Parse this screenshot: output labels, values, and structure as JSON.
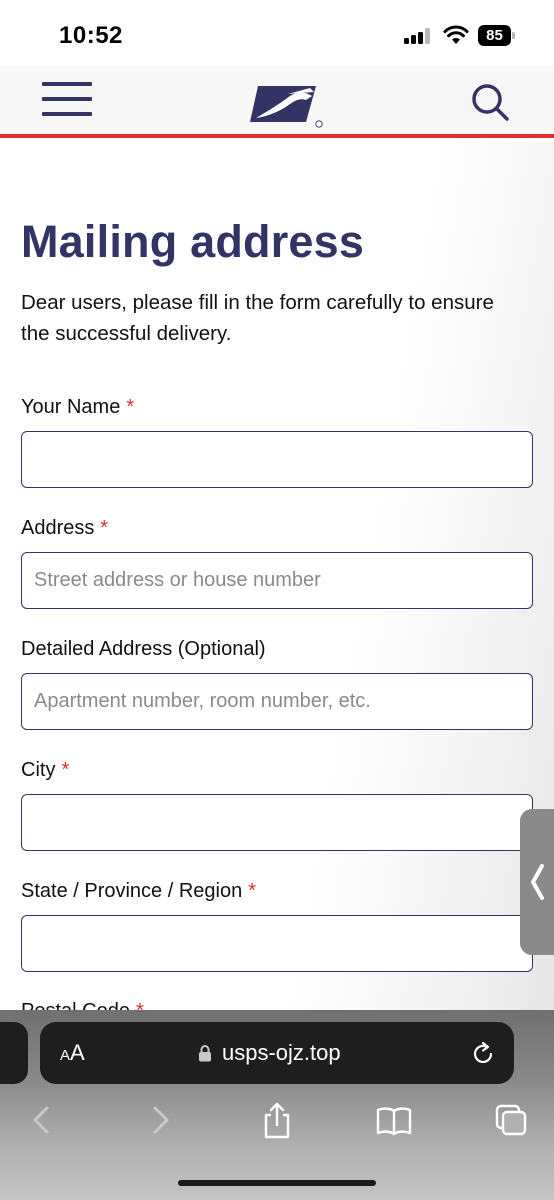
{
  "status_bar": {
    "time": "10:52",
    "battery": "85"
  },
  "header": {
    "menu_icon": "hamburger-menu-icon",
    "logo_icon": "usps-eagle-logo",
    "search_icon": "search-icon"
  },
  "main": {
    "title": "Mailing address",
    "intro": "Dear users, please fill in the form carefully to ensure the successful delivery.",
    "fields": [
      {
        "label": "Your Name",
        "required_mark": "*",
        "placeholder": "",
        "value": ""
      },
      {
        "label": "Address",
        "required_mark": "*",
        "placeholder": "Street address or house number",
        "value": ""
      },
      {
        "label": "Detailed Address (Optional)",
        "required_mark": "",
        "placeholder": "Apartment number, room number, etc.",
        "value": ""
      },
      {
        "label": "City",
        "required_mark": "*",
        "placeholder": "",
        "value": ""
      },
      {
        "label": "State / Province / Region",
        "required_mark": "*",
        "placeholder": "",
        "value": ""
      },
      {
        "label": "Postal Code",
        "required_mark": "*",
        "placeholder": "",
        "value": ""
      }
    ]
  },
  "browser": {
    "aa_large": "A",
    "aa_small": "A",
    "url": "usps-ojz.top",
    "toolbar_icons": [
      "back-icon",
      "forward-icon",
      "share-icon",
      "bookmarks-icon",
      "tabs-icon"
    ]
  },
  "colors": {
    "brand_navy": "#333366",
    "brand_red": "#e12c2c"
  }
}
